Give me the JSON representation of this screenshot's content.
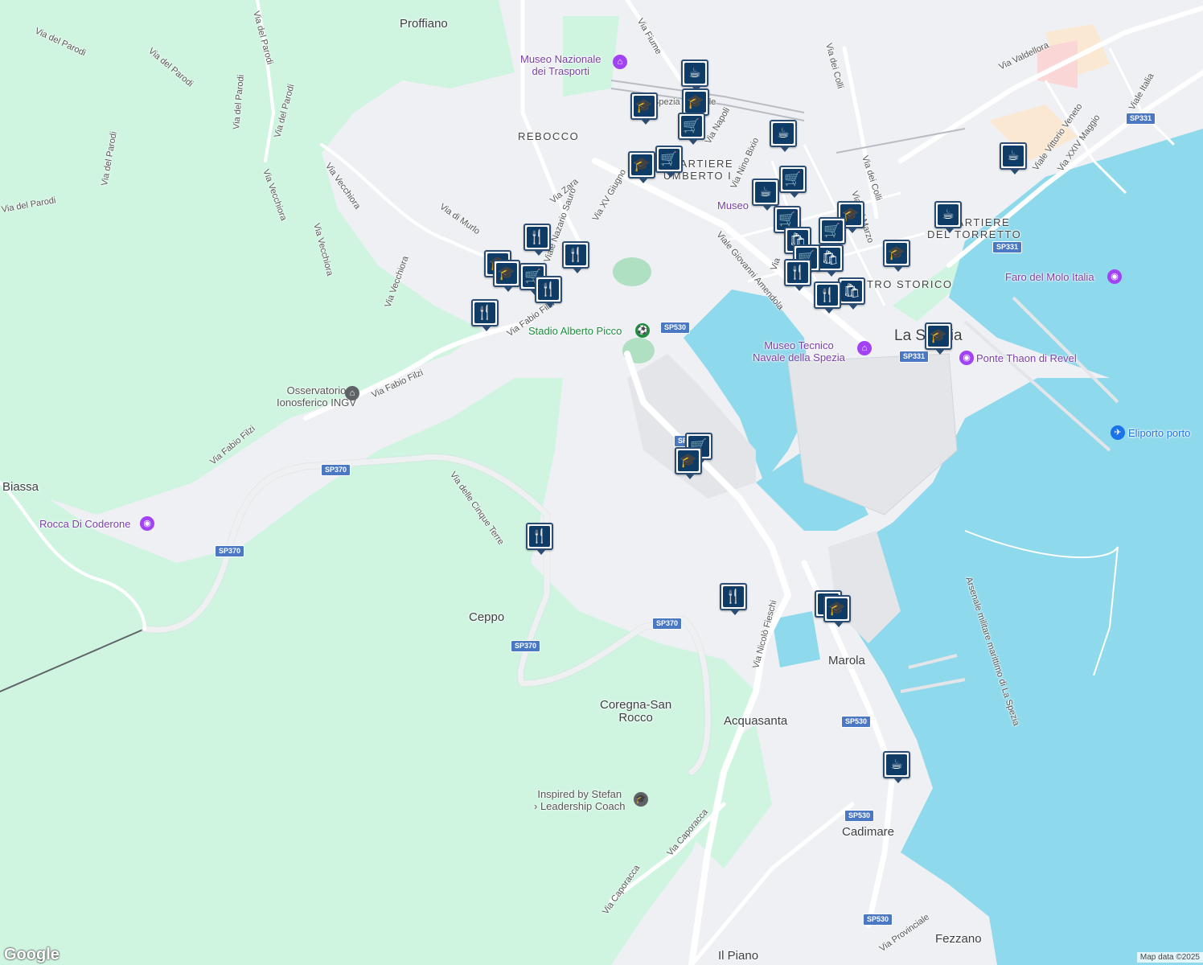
{
  "map": {
    "colors": {
      "water": "#8fd9ec",
      "land": "#eef0f3",
      "park": "#cff5e0",
      "road": "#ffffff",
      "highway_shield": "#4a78c2",
      "marker_border": "#2c4d73",
      "marker_fill": "#0f3c67"
    },
    "places": {
      "proffiano": "Proffiano",
      "rebocco": "REBOCCO",
      "biassa": "Biassa",
      "ceppo": "Ceppo",
      "coregna": "Coregna-San\nRocco",
      "acquasanta": "Acquasanta",
      "marola": "Marola",
      "cadimare": "Cadimare",
      "fezzano": "Fezzano",
      "il_piano": "Il Piano",
      "la_spezia": "La Spezia",
      "quartiere_umberto": "QUARTIERE\nUMBERTO I",
      "quartiere_torretto": "QUARTIERE\nDEL TORRETTO",
      "centro_storico": "CENTRO STORICO"
    },
    "pois": {
      "museo_trasporti": "Museo Nazionale\ndei Trasporti",
      "stadio": "Stadio Alberto Picco",
      "osservatorio": "Osservatorio\nIonosferico INGV",
      "rocca": "Rocca Di Coderone",
      "museo_navale": "Museo Tecnico\nNavale della Spezia",
      "faro": "Faro del Molo Italia",
      "ponte": "Ponte Thaon di Revel",
      "eliporto": "Eliporto porto",
      "inspired": "Inspired by Stefan\n› Leadership Coach",
      "museo_short": "Museo",
      "stazione": "Spezia Centrale",
      "arsenale": "Arsenale militare marittimo di La Spezia"
    },
    "streets": {
      "via_del_parodi": "Via del Parodi",
      "via_vecchiora": "Via Vecchiora",
      "via_fabio_filzi": "Via Fabio Filzi",
      "via_cinque_terre": "Via delle Cinque Terre",
      "via_di_murlo": "Via di Murlo",
      "via_zara": "Via Zara",
      "viale_nazario_sauro": "Viale Nazario Sauro",
      "via_xv_giugno": "Via XV Giugno",
      "via_fiume": "Via Fiume",
      "via_napoli": "Via Napoli",
      "via_nino_bixio": "Via Nino Bixio",
      "via_dei_colli": "Via dei Colli",
      "via_xx_marzo": "Via XX Marzo",
      "via_valdellora": "Via Valdellora",
      "viale_vittorio_veneto": "Viale Vittorio Veneto",
      "via_xxiv_maggio": "Via XXIV Maggio",
      "viale_italia": "Viale Italia",
      "viale_amendola": "Viale Giovanni Amendola",
      "via_fieschi": "Via Nicolò Fieschi",
      "via_caporacca": "Via Caporacca",
      "via_provinciale": "Via Provinciale",
      "via_short": "Via"
    },
    "shields": [
      "SP530",
      "SP331",
      "SP370"
    ],
    "markers": [
      {
        "type": "cafe",
        "glyph": "☕"
      },
      {
        "type": "restaurant",
        "glyph": "🍴"
      },
      {
        "type": "school",
        "glyph": "🎓"
      },
      {
        "type": "shopping",
        "glyph": "🛒"
      },
      {
        "type": "store",
        "glyph": "🛍"
      }
    ],
    "attribution": "Map data ©2025",
    "logo": "Google"
  }
}
